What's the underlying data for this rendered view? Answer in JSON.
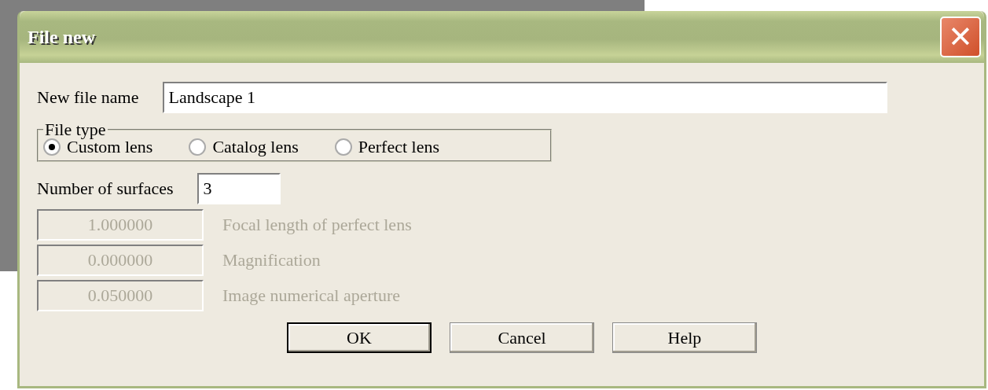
{
  "window": {
    "title": "File new",
    "close_symbol": "✕"
  },
  "file_name": {
    "label": "New file name",
    "value": "Landscape 1"
  },
  "file_type": {
    "legend": "File type",
    "options": [
      {
        "label": "Custom lens",
        "selected": true
      },
      {
        "label": "Catalog lens",
        "selected": false
      },
      {
        "label": "Perfect lens",
        "selected": false
      }
    ]
  },
  "surfaces": {
    "label": "Number of surfaces",
    "value": "3"
  },
  "perfect_lens_fields": [
    {
      "value": "1.000000",
      "label": "Focal length of perfect lens",
      "disabled": true
    },
    {
      "value": "0.000000",
      "label": "Magnification",
      "disabled": true
    },
    {
      "value": "0.050000",
      "label": "Image numerical aperture",
      "disabled": true
    }
  ],
  "buttons": [
    {
      "label": "OK",
      "default": true
    },
    {
      "label": "Cancel",
      "default": false
    },
    {
      "label": "Help",
      "default": false
    }
  ]
}
